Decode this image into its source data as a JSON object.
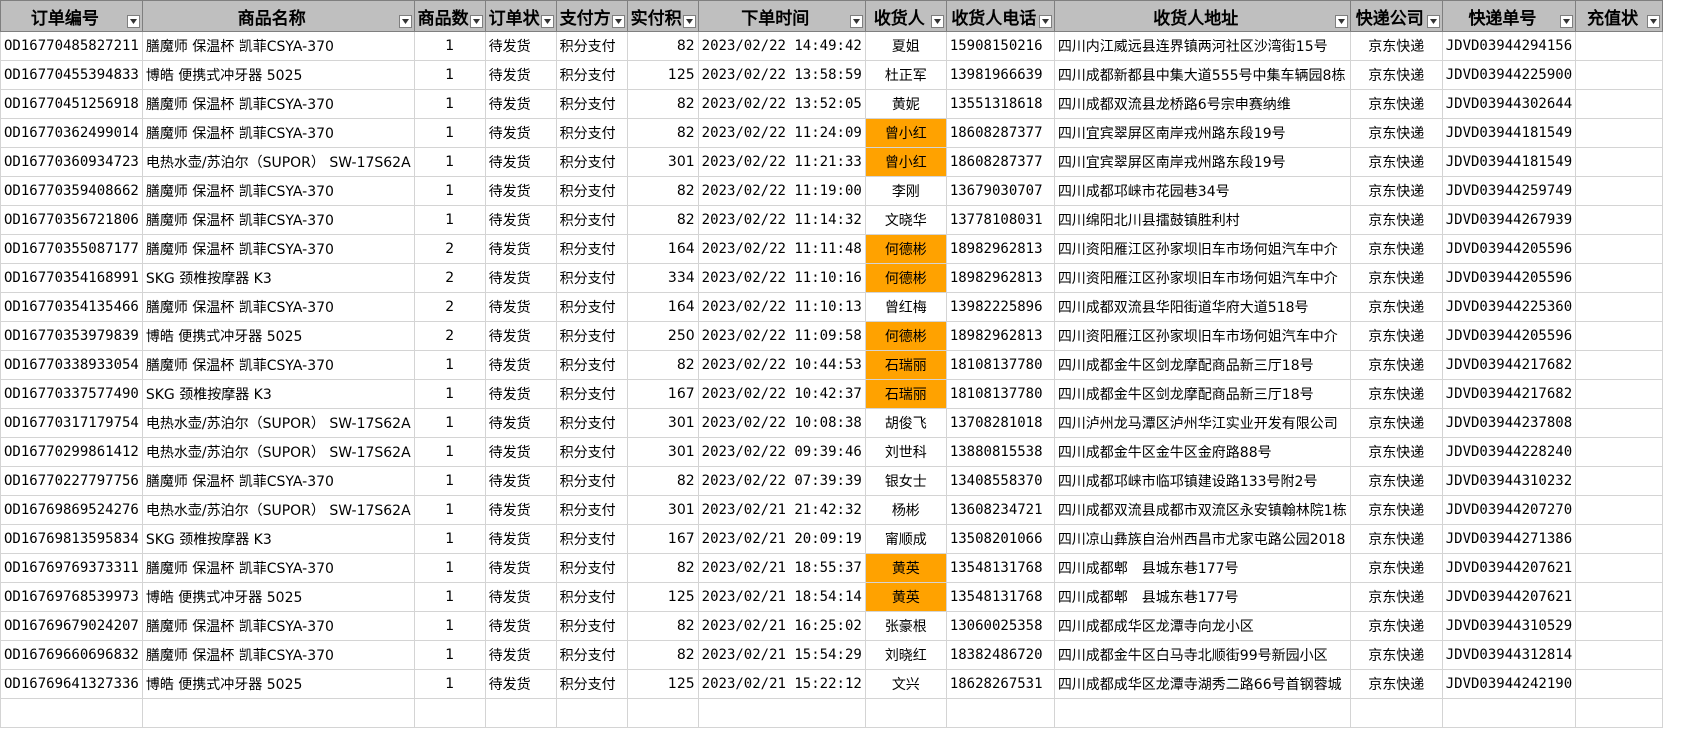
{
  "columns": [
    {
      "key": "order_id",
      "label": "订单编号"
    },
    {
      "key": "product",
      "label": "商品名称"
    },
    {
      "key": "qty",
      "label": "商品数"
    },
    {
      "key": "status",
      "label": "订单状"
    },
    {
      "key": "payment",
      "label": "支付方"
    },
    {
      "key": "amount",
      "label": "实付积"
    },
    {
      "key": "time",
      "label": "下单时间"
    },
    {
      "key": "recipient",
      "label": "收货人"
    },
    {
      "key": "phone",
      "label": "收货人电话"
    },
    {
      "key": "address",
      "label": "收货人地址"
    },
    {
      "key": "courier",
      "label": "快递公司"
    },
    {
      "key": "tracking",
      "label": "快递单号"
    },
    {
      "key": "recharge",
      "label": "充值状"
    }
  ],
  "highlight_color": "#ffa200",
  "rows": [
    {
      "order_id": "OD16770485827211",
      "product": "膳魔师 保温杯 凯菲CSYA-370",
      "qty": "1",
      "status": "待发货",
      "payment": "积分支付",
      "amount": "82",
      "time": "2023/02/22 14:49:42",
      "recipient": "夏姐",
      "phone": "15908150216",
      "address": "四川内江威远县连界镇两河社区沙湾街15号",
      "courier": "京东快递",
      "tracking": "JDVD03944294156",
      "recharge": "",
      "highlight": false
    },
    {
      "order_id": "OD16770455394833",
      "product": "博皓 便携式冲牙器 5025",
      "qty": "1",
      "status": "待发货",
      "payment": "积分支付",
      "amount": "125",
      "time": "2023/02/22 13:58:59",
      "recipient": "杜正军",
      "phone": "13981966639",
      "address": "四川成都新都县中集大道555号中集车辆园8栋",
      "courier": "京东快递",
      "tracking": "JDVD03944225900",
      "recharge": "",
      "highlight": false
    },
    {
      "order_id": "OD16770451256918",
      "product": "膳魔师 保温杯 凯菲CSYA-370",
      "qty": "1",
      "status": "待发货",
      "payment": "积分支付",
      "amount": "82",
      "time": "2023/02/22 13:52:05",
      "recipient": "黄妮",
      "phone": "13551318618",
      "address": "四川成都双流县龙桥路6号宗申赛纳维",
      "courier": "京东快递",
      "tracking": "JDVD03944302644",
      "recharge": "",
      "highlight": false
    },
    {
      "order_id": "OD16770362499014",
      "product": "膳魔师 保温杯 凯菲CSYA-370",
      "qty": "1",
      "status": "待发货",
      "payment": "积分支付",
      "amount": "82",
      "time": "2023/02/22 11:24:09",
      "recipient": "曾小红",
      "phone": "18608287377",
      "address": "四川宜宾翠屏区南岸戎州路东段19号",
      "courier": "京东快递",
      "tracking": "JDVD03944181549",
      "recharge": "",
      "highlight": true
    },
    {
      "order_id": "OD16770360934723",
      "product": "电热水壶/苏泊尔（SUPOR） SW-17S62A",
      "qty": "1",
      "status": "待发货",
      "payment": "积分支付",
      "amount": "301",
      "time": "2023/02/22 11:21:33",
      "recipient": "曾小红",
      "phone": "18608287377",
      "address": "四川宜宾翠屏区南岸戎州路东段19号",
      "courier": "京东快递",
      "tracking": "JDVD03944181549",
      "recharge": "",
      "highlight": true
    },
    {
      "order_id": "OD16770359408662",
      "product": "膳魔师 保温杯 凯菲CSYA-370",
      "qty": "1",
      "status": "待发货",
      "payment": "积分支付",
      "amount": "82",
      "time": "2023/02/22 11:19:00",
      "recipient": "李刚",
      "phone": "13679030707",
      "address": "四川成都邛崃市花园巷34号",
      "courier": "京东快递",
      "tracking": "JDVD03944259749",
      "recharge": "",
      "highlight": false
    },
    {
      "order_id": "OD16770356721806",
      "product": "膳魔师 保温杯 凯菲CSYA-370",
      "qty": "1",
      "status": "待发货",
      "payment": "积分支付",
      "amount": "82",
      "time": "2023/02/22 11:14:32",
      "recipient": "文晓华",
      "phone": "13778108031",
      "address": "四川绵阳北川县擂鼓镇胜利村",
      "courier": "京东快递",
      "tracking": "JDVD03944267939",
      "recharge": "",
      "highlight": false
    },
    {
      "order_id": "OD16770355087177",
      "product": "膳魔师 保温杯 凯菲CSYA-370",
      "qty": "2",
      "status": "待发货",
      "payment": "积分支付",
      "amount": "164",
      "time": "2023/02/22 11:11:48",
      "recipient": "何德彬",
      "phone": "18982962813",
      "address": "四川资阳雁江区孙家坝旧车市场何姐汽车中介",
      "courier": "京东快递",
      "tracking": "JDVD03944205596",
      "recharge": "",
      "highlight": true
    },
    {
      "order_id": "OD16770354168991",
      "product": "SKG 颈椎按摩器 K3",
      "qty": "2",
      "status": "待发货",
      "payment": "积分支付",
      "amount": "334",
      "time": "2023/02/22 11:10:16",
      "recipient": "何德彬",
      "phone": "18982962813",
      "address": "四川资阳雁江区孙家坝旧车市场何姐汽车中介",
      "courier": "京东快递",
      "tracking": "JDVD03944205596",
      "recharge": "",
      "highlight": true
    },
    {
      "order_id": "OD16770354135466",
      "product": "膳魔师 保温杯 凯菲CSYA-370",
      "qty": "2",
      "status": "待发货",
      "payment": "积分支付",
      "amount": "164",
      "time": "2023/02/22 11:10:13",
      "recipient": "曾红梅",
      "phone": "13982225896",
      "address": "四川成都双流县华阳街道华府大道518号",
      "courier": "京东快递",
      "tracking": "JDVD03944225360",
      "recharge": "",
      "highlight": false
    },
    {
      "order_id": "OD16770353979839",
      "product": "博皓 便携式冲牙器 5025",
      "qty": "2",
      "status": "待发货",
      "payment": "积分支付",
      "amount": "250",
      "time": "2023/02/22 11:09:58",
      "recipient": "何德彬",
      "phone": "18982962813",
      "address": "四川资阳雁江区孙家坝旧车市场何姐汽车中介",
      "courier": "京东快递",
      "tracking": "JDVD03944205596",
      "recharge": "",
      "highlight": true
    },
    {
      "order_id": "OD16770338933054",
      "product": "膳魔师 保温杯 凯菲CSYA-370",
      "qty": "1",
      "status": "待发货",
      "payment": "积分支付",
      "amount": "82",
      "time": "2023/02/22 10:44:53",
      "recipient": "石瑞丽",
      "phone": "18108137780",
      "address": "四川成都金牛区剑龙摩配商品新三厅18号",
      "courier": "京东快递",
      "tracking": "JDVD03944217682",
      "recharge": "",
      "highlight": true
    },
    {
      "order_id": "OD16770337577490",
      "product": "SKG 颈椎按摩器 K3",
      "qty": "1",
      "status": "待发货",
      "payment": "积分支付",
      "amount": "167",
      "time": "2023/02/22 10:42:37",
      "recipient": "石瑞丽",
      "phone": "18108137780",
      "address": "四川成都金牛区剑龙摩配商品新三厅18号",
      "courier": "京东快递",
      "tracking": "JDVD03944217682",
      "recharge": "",
      "highlight": true
    },
    {
      "order_id": "OD16770317179754",
      "product": "电热水壶/苏泊尔（SUPOR） SW-17S62A",
      "qty": "1",
      "status": "待发货",
      "payment": "积分支付",
      "amount": "301",
      "time": "2023/02/22 10:08:38",
      "recipient": "胡俊飞",
      "phone": "13708281018",
      "address": "四川泸州龙马潭区泸州华江实业开发有限公司",
      "courier": "京东快递",
      "tracking": "JDVD03944237808",
      "recharge": "",
      "highlight": false
    },
    {
      "order_id": "OD16770299861412",
      "product": "电热水壶/苏泊尔（SUPOR） SW-17S62A",
      "qty": "1",
      "status": "待发货",
      "payment": "积分支付",
      "amount": "301",
      "time": "2023/02/22 09:39:46",
      "recipient": "刘世科",
      "phone": "13880815538",
      "address": "四川成都金牛区金牛区金府路88号",
      "courier": "京东快递",
      "tracking": "JDVD03944228240",
      "recharge": "",
      "highlight": false
    },
    {
      "order_id": "OD16770227797756",
      "product": "膳魔师 保温杯 凯菲CSYA-370",
      "qty": "1",
      "status": "待发货",
      "payment": "积分支付",
      "amount": "82",
      "time": "2023/02/22 07:39:39",
      "recipient": "银女士",
      "phone": "13408558370",
      "address": "四川成都邛崃市临邛镇建设路133号附2号",
      "courier": "京东快递",
      "tracking": "JDVD03944310232",
      "recharge": "",
      "highlight": false
    },
    {
      "order_id": "OD16769869524276",
      "product": "电热水壶/苏泊尔（SUPOR） SW-17S62A",
      "qty": "1",
      "status": "待发货",
      "payment": "积分支付",
      "amount": "301",
      "time": "2023/02/21 21:42:32",
      "recipient": "杨彬",
      "phone": "13608234721",
      "address": "四川成都双流县成都市双流区永安镇翰林院1栋",
      "courier": "京东快递",
      "tracking": "JDVD03944207270",
      "recharge": "",
      "highlight": false
    },
    {
      "order_id": "OD16769813595834",
      "product": "SKG 颈椎按摩器 K3",
      "qty": "1",
      "status": "待发货",
      "payment": "积分支付",
      "amount": "167",
      "time": "2023/02/21 20:09:19",
      "recipient": "甯顺成",
      "phone": "13508201066",
      "address": "四川凉山彝族自治州西昌市尤家屯路公园2018",
      "courier": "京东快递",
      "tracking": "JDVD03944271386",
      "recharge": "",
      "highlight": false
    },
    {
      "order_id": "OD16769769373311",
      "product": "膳魔师 保温杯 凯菲CSYA-370",
      "qty": "1",
      "status": "待发货",
      "payment": "积分支付",
      "amount": "82",
      "time": "2023/02/21 18:55:37",
      "recipient": "黄英",
      "phone": "13548131768",
      "address": "四川成都郫　县城东巷177号",
      "courier": "京东快递",
      "tracking": "JDVD03944207621",
      "recharge": "",
      "highlight": true
    },
    {
      "order_id": "OD16769768539973",
      "product": "博皓 便携式冲牙器 5025",
      "qty": "1",
      "status": "待发货",
      "payment": "积分支付",
      "amount": "125",
      "time": "2023/02/21 18:54:14",
      "recipient": "黄英",
      "phone": "13548131768",
      "address": "四川成都郫　县城东巷177号",
      "courier": "京东快递",
      "tracking": "JDVD03944207621",
      "recharge": "",
      "highlight": true
    },
    {
      "order_id": "OD16769679024207",
      "product": "膳魔师 保温杯 凯菲CSYA-370",
      "qty": "1",
      "status": "待发货",
      "payment": "积分支付",
      "amount": "82",
      "time": "2023/02/21 16:25:02",
      "recipient": "张豪根",
      "phone": "13060025358",
      "address": "四川成都成华区龙潭寺向龙小区",
      "courier": "京东快递",
      "tracking": "JDVD03944310529",
      "recharge": "",
      "highlight": false
    },
    {
      "order_id": "OD16769660696832",
      "product": "膳魔师 保温杯 凯菲CSYA-370",
      "qty": "1",
      "status": "待发货",
      "payment": "积分支付",
      "amount": "82",
      "time": "2023/02/21 15:54:29",
      "recipient": "刘晓红",
      "phone": "18382486720",
      "address": "四川成都金牛区白马寺北顺街99号新园小区",
      "courier": "京东快递",
      "tracking": "JDVD03944312814",
      "recharge": "",
      "highlight": false
    },
    {
      "order_id": "OD16769641327336",
      "product": "博皓 便携式冲牙器 5025",
      "qty": "1",
      "status": "待发货",
      "payment": "积分支付",
      "amount": "125",
      "time": "2023/02/21 15:22:12",
      "recipient": "文兴",
      "phone": "18628267531",
      "address": "四川成都成华区龙潭寺湖秀二路66号首钢蓉城",
      "courier": "京东快递",
      "tracking": "JDVD03944242190",
      "recharge": "",
      "highlight": false
    }
  ]
}
